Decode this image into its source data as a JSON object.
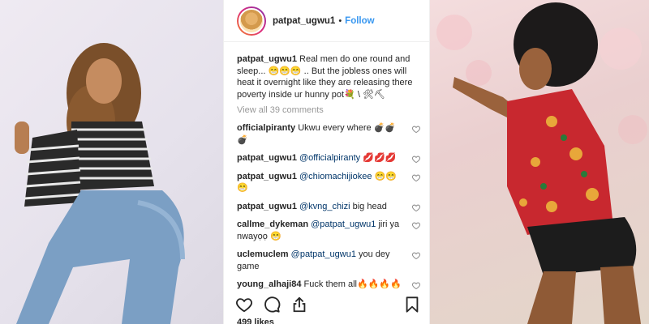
{
  "post": {
    "username": "patpat_ugwu1",
    "separator": "•",
    "follow_label": "Follow",
    "caption_user": "patpat_ugwu1",
    "caption_text": "Real men do one round and sleep... 😁😁😁 .. But the jobless ones will heat it overnight like they are releasing there poverty inside ur hunny pot💐 \\ 🛠⛏",
    "view_all": "View all 39 comments",
    "likes": "499 likes"
  },
  "comments": [
    {
      "user": "officialpiranty",
      "mention": "",
      "text": "Ukwu every where 💣💣💣"
    },
    {
      "user": "patpat_ugwu1",
      "mention": "@officialpiranty",
      "text": "💋💋💋"
    },
    {
      "user": "patpat_ugwu1",
      "mention": "@chiomachijiokee",
      "text": "😁😁😁"
    },
    {
      "user": "patpat_ugwu1",
      "mention": "@kvng_chizi",
      "text": "big head"
    },
    {
      "user": "callme_dykeman",
      "mention": "@patpat_ugwu1",
      "text": "jiri ya nwayọọ 😁"
    },
    {
      "user": "uclemuclem",
      "mention": "@patpat_ugwu1",
      "text": "you dey game"
    },
    {
      "user": "young_alhaji84",
      "mention": "",
      "text": "Fuck them all🔥🔥🔥🔥"
    }
  ],
  "icons": {
    "like": "heart-icon",
    "comment": "comment-icon",
    "share": "share-icon",
    "save": "bookmark-icon"
  },
  "colors": {
    "follow": "#3897f0",
    "mention": "#003569",
    "muted": "#999999"
  }
}
